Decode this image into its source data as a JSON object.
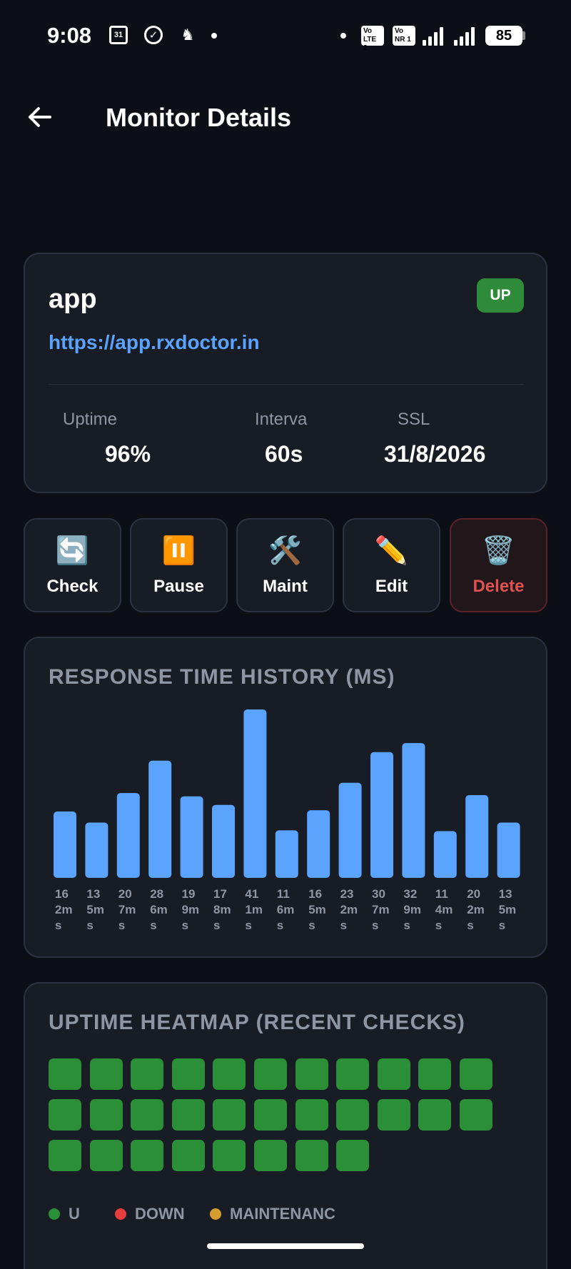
{
  "status_bar": {
    "time": "9:08",
    "calendar_day": "31",
    "sim1_label": "Vo LTE 2",
    "sim2_label": "Vo NR 1",
    "battery": "85"
  },
  "header": {
    "title": "Monitor Details"
  },
  "monitor": {
    "name": "app",
    "url": "https://app.rxdoctor.in",
    "status": "UP",
    "status_color": "#2e8b3a",
    "stats": [
      {
        "label": "Uptime",
        "value": "96%"
      },
      {
        "label": "Interva",
        "value": "60s"
      },
      {
        "label": "SSL",
        "value": "31/8/2026"
      }
    ]
  },
  "actions": [
    {
      "icon": "refresh-icon",
      "glyph": "🔄",
      "label": "Check"
    },
    {
      "icon": "pause-icon",
      "glyph": "⏸️",
      "label": "Pause"
    },
    {
      "icon": "tools-icon",
      "glyph": "🛠️",
      "label": "Maint"
    },
    {
      "icon": "pencil-icon",
      "glyph": "✏️",
      "label": "Edit"
    },
    {
      "icon": "trash-icon",
      "glyph": "🗑️",
      "label": "Delete"
    }
  ],
  "chart_data": {
    "type": "bar",
    "title": "RESPONSE TIME HISTORY (MS)",
    "categories": [
      "162ms",
      "135ms",
      "207ms",
      "286ms",
      "199ms",
      "178ms",
      "411ms",
      "116ms",
      "165ms",
      "232ms",
      "307ms",
      "329ms",
      "114ms",
      "202ms",
      "135ms"
    ],
    "values": [
      162,
      135,
      207,
      286,
      199,
      178,
      411,
      116,
      165,
      232,
      307,
      329,
      114,
      202,
      135
    ],
    "bar_color": "#5aa3ff",
    "ylim": [
      0,
      411
    ]
  },
  "heatmap": {
    "title": "UPTIME HEATMAP (RECENT CHECKS)",
    "cells": [
      "up",
      "up",
      "up",
      "up",
      "up",
      "up",
      "up",
      "up",
      "up",
      "up",
      "up",
      "up",
      "up",
      "up",
      "up",
      "up",
      "up",
      "up",
      "up",
      "up",
      "up",
      "up",
      "up",
      "up",
      "up",
      "up",
      "up",
      "up",
      "up",
      "up"
    ],
    "colors": {
      "up": "#2a8f36",
      "down": "#e53e3e",
      "maintenance": "#d69e2e"
    },
    "legend": [
      {
        "key": "up",
        "label": "U"
      },
      {
        "key": "down",
        "label": "DOWN"
      },
      {
        "key": "maintenance",
        "label": "MAINTENANC"
      }
    ]
  }
}
